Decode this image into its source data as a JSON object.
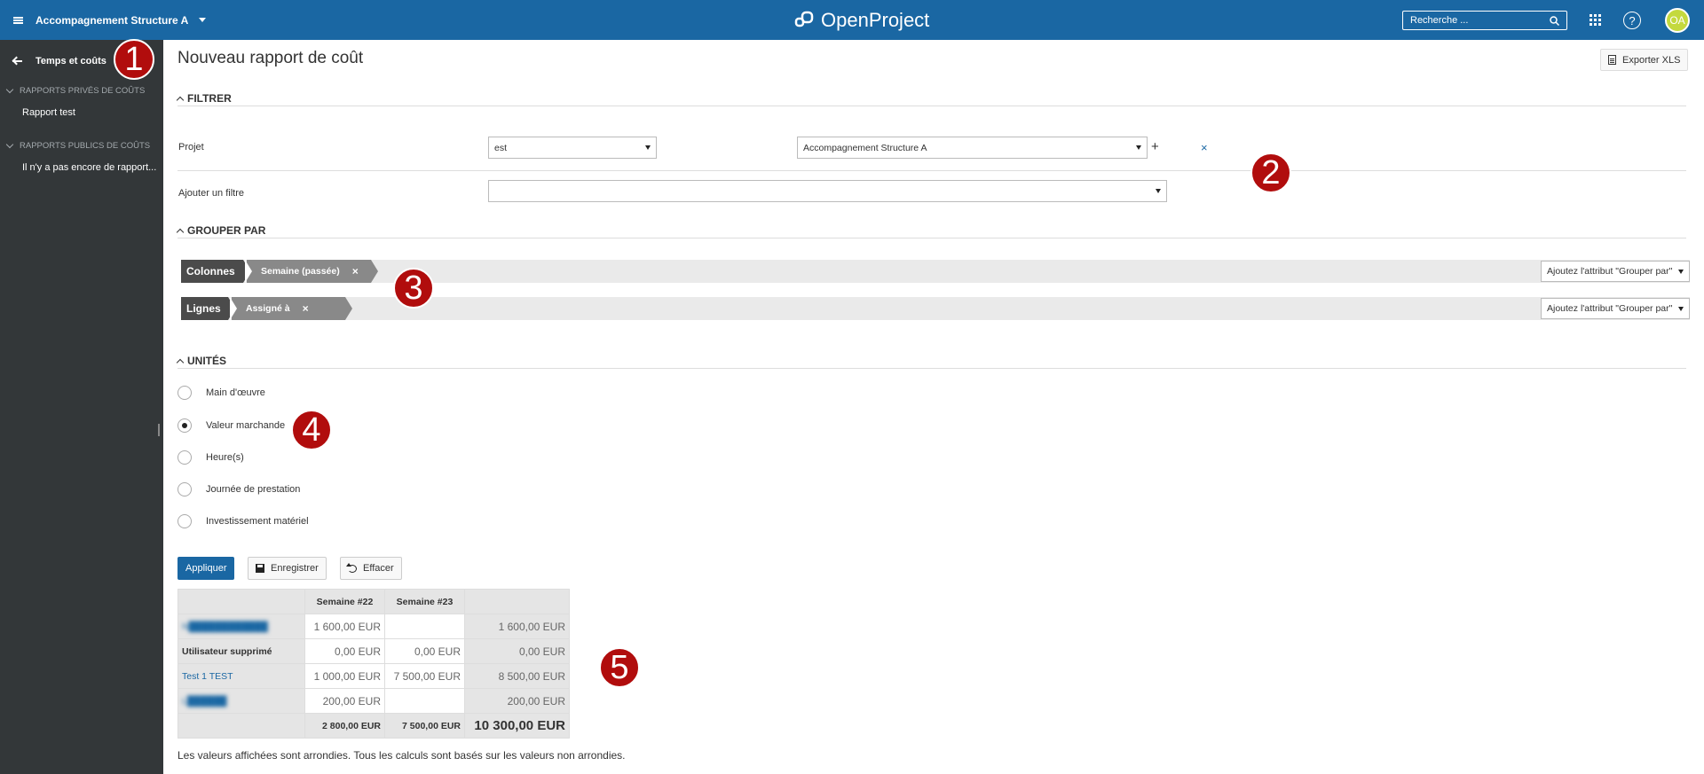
{
  "header": {
    "project": "Accompagnement Structure A",
    "logo_text": "OpenProject",
    "search_placeholder": "Recherche ...",
    "avatar_initials": "OA",
    "help_glyph": "?",
    "brand_color": "#1a67a3"
  },
  "sidebar": {
    "title": "Temps et coûts",
    "private_section": "RAPPORTS PRIVÉS DE COÛTS",
    "private_items": [
      "Rapport test"
    ],
    "public_section": "RAPPORTS PUBLICS DE COÛTS",
    "public_items": [
      "Il n'y a pas encore de rapport..."
    ]
  },
  "badges": [
    "1",
    "2",
    "3",
    "4",
    "5"
  ],
  "page": {
    "title": "Nouveau rapport de coût",
    "export_label": "Exporter XLS"
  },
  "filter": {
    "section": "FILTRER",
    "project_label": "Projet",
    "operator": "est",
    "project_value": "Accompagnement Structure A",
    "plus": "+",
    "remove": "×",
    "add_label": "Ajouter un filtre",
    "add_value": ""
  },
  "group_by": {
    "section": "GROUPER PAR",
    "columns_label": "Colonnes",
    "columns_value": "Semaine (passée)",
    "rows_label": "Lignes",
    "rows_value": "Assigné à",
    "chip_remove": "×",
    "add_attr": "Ajoutez l'attribut \"Grouper par\""
  },
  "units": {
    "section": "UNITÉS",
    "options": [
      "Main d'œuvre",
      "Valeur marchande",
      "Heure(s)",
      "Journée de prestation",
      "Investissement matériel"
    ],
    "selected_index": 1
  },
  "actions": {
    "apply": "Appliquer",
    "save": "Enregistrer",
    "clear": "Effacer"
  },
  "table": {
    "headers": [
      "",
      "Semaine #22",
      "Semaine #23",
      ""
    ],
    "rows": [
      {
        "name": "N",
        "name_blurred": "N████████████",
        "w22": "1 600,00 EUR",
        "w23": "",
        "total": "1 600,00 EUR"
      },
      {
        "name": "Utilisateur supprimé",
        "w22": "0,00 EUR",
        "w23": "0,00 EUR",
        "total": "0,00 EUR"
      },
      {
        "name": "Test 1 TEST",
        "w22": "1 000,00 EUR",
        "w23": "7 500,00 EUR",
        "total": "8 500,00 EUR"
      },
      {
        "name": "L",
        "name_blurred": "L██████",
        "w22": "200,00 EUR",
        "w23": "",
        "total": "200,00 EUR"
      }
    ],
    "footer": {
      "w22": "2 800,00 EUR",
      "w23": "7 500,00 EUR",
      "total": "10 300,00 EUR"
    }
  },
  "note": "Les valeurs affichées sont arrondies. Tous les calculs sont basés sur les valeurs non arrondies."
}
